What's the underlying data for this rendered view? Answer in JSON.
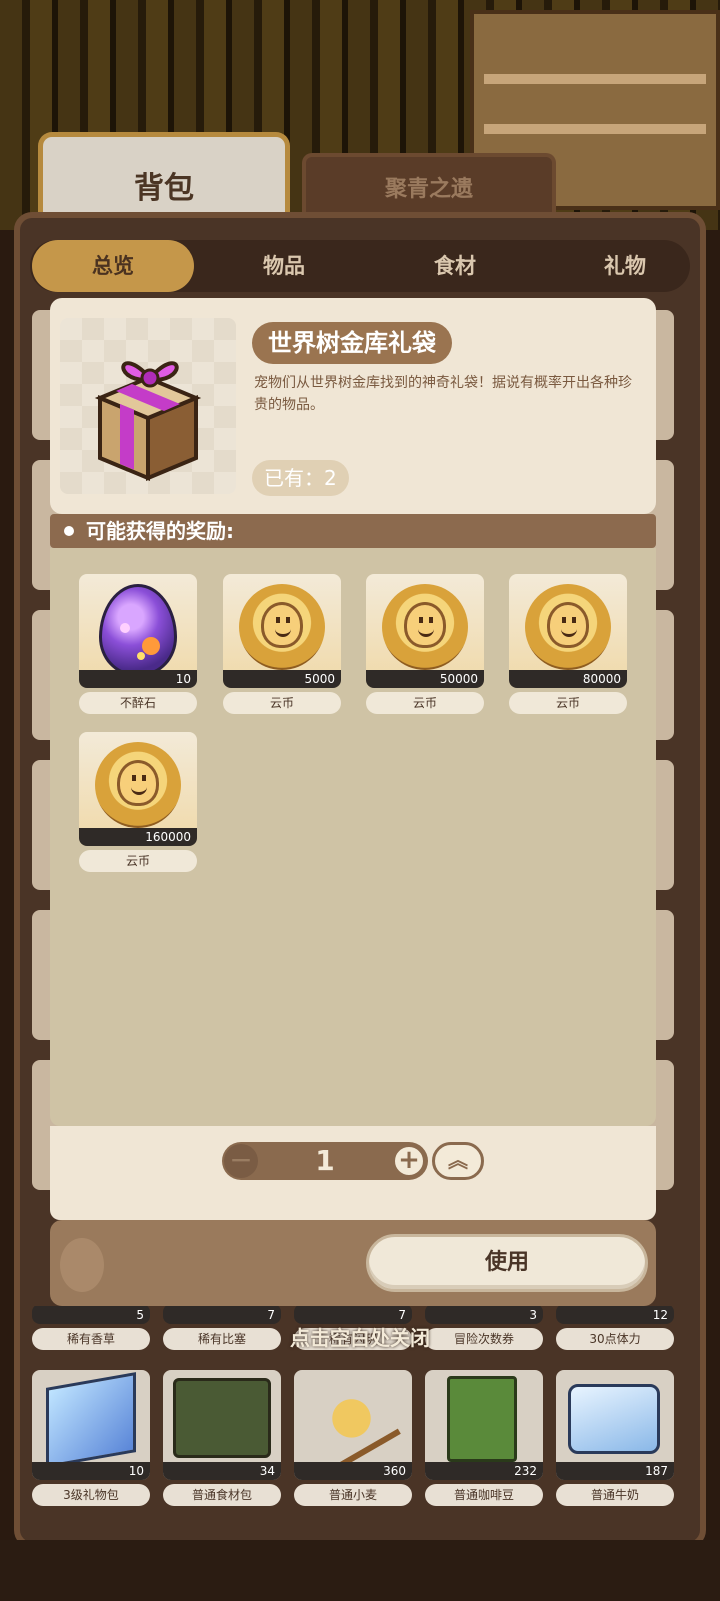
{
  "tabs": {
    "primary": "背包",
    "secondary": "聚青之遗"
  },
  "categories": [
    {
      "label": "总览",
      "active": true
    },
    {
      "label": "物品",
      "active": false
    },
    {
      "label": "食材",
      "active": false
    },
    {
      "label": "礼物",
      "active": false
    }
  ],
  "item": {
    "name": "世界树金库礼袋",
    "description": "宠物们从世界树金库找到的神奇礼袋！据说有概率开出各种珍贵的物品。",
    "owned": "已有：2",
    "icon": "gift-box-icon"
  },
  "rewards": {
    "header": "可能获得的奖励:",
    "list": [
      {
        "name": "不醉石",
        "qty": "10",
        "icon": "gem-egg-icon"
      },
      {
        "name": "云币",
        "qty": "5000",
        "icon": "coin-icon"
      },
      {
        "name": "云币",
        "qty": "50000",
        "icon": "coin-icon"
      },
      {
        "name": "云币",
        "qty": "80000",
        "icon": "coin-icon"
      },
      {
        "name": "云币",
        "qty": "160000",
        "icon": "coin-icon"
      }
    ]
  },
  "stepper": {
    "value": "1",
    "minus": "−",
    "plus": "+",
    "max": "︽"
  },
  "use_button": "使用",
  "close_hint": "点击空白处关闭",
  "inventory_row1": [
    {
      "name": "稀有香草",
      "qty": "5"
    },
    {
      "name": "稀有比塞",
      "qty": "7"
    },
    {
      "name": "稀有闪玥",
      "qty": "7"
    },
    {
      "name": "冒险次数券",
      "qty": "3"
    },
    {
      "name": "30点体力",
      "qty": "12"
    }
  ],
  "inventory_row2": [
    {
      "name": "3级礼物包",
      "qty": "10",
      "icon": "gift-crystal-icon"
    },
    {
      "name": "普通食材包",
      "qty": "34",
      "icon": "suitcase-icon"
    },
    {
      "name": "普通小麦",
      "qty": "360",
      "icon": "wheat-icon"
    },
    {
      "name": "普通咖啡豆",
      "qty": "232",
      "icon": "coffee-bag-icon"
    },
    {
      "name": "普通牛奶",
      "qty": "187",
      "icon": "milk-icon"
    }
  ],
  "colors": {
    "accent": "#c5974a",
    "panel": "#4a3426",
    "card": "#f0e6d5",
    "title_bg": "#9a7450"
  }
}
